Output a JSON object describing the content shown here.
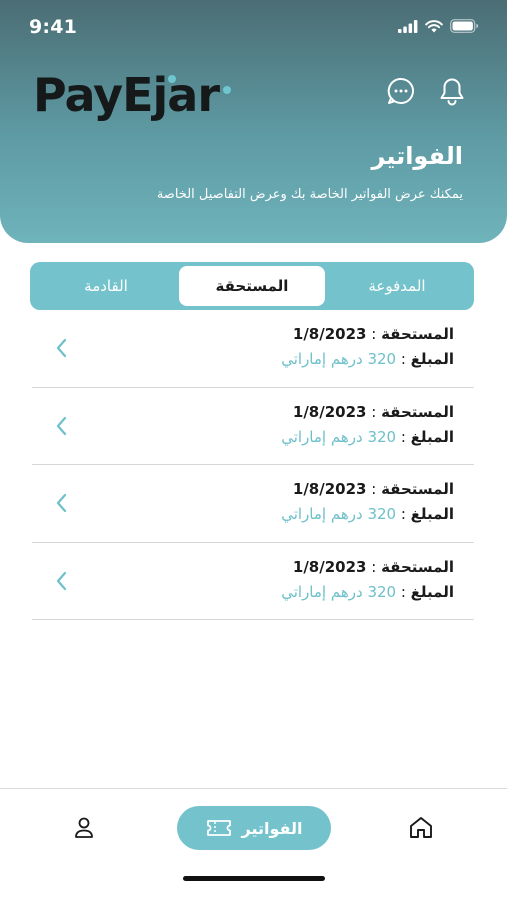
{
  "status_bar": {
    "time": "9:41"
  },
  "brand": {
    "logo_text": "PayEjar",
    "accent_color": "#6ec7d0"
  },
  "header": {
    "title": "الفواتير",
    "subtitle": "يمكنك عرض الفواتير الخاصة بك وعرض التفاصيل الخاصة",
    "chat_icon": "chat-bubble-icon",
    "notification_icon": "bell-icon"
  },
  "tabs": [
    {
      "label": "المدفوعة",
      "selected": false
    },
    {
      "label": "المستحقة",
      "selected": true
    },
    {
      "label": "القادمة",
      "selected": false
    }
  ],
  "invoices": [
    {
      "due_label": "المستحقة",
      "due_separator": " : ",
      "due_date": "1/8/2023",
      "amount_label": "المبلغ",
      "amount_separator": " : ",
      "amount": "320 درهم إماراتي"
    },
    {
      "due_label": "المستحقة",
      "due_separator": " : ",
      "due_date": "1/8/2023",
      "amount_label": "المبلغ",
      "amount_separator": " : ",
      "amount": "320 درهم إماراتي"
    },
    {
      "due_label": "المستحقة",
      "due_separator": " : ",
      "due_date": "1/8/2023",
      "amount_label": "المبلغ",
      "amount_separator": " : ",
      "amount": "320 درهم إماراتي"
    },
    {
      "due_label": "المستحقة",
      "due_separator": " : ",
      "due_date": "1/8/2023",
      "amount_label": "المبلغ",
      "amount_separator": " : ",
      "amount": "320 درهم إماراتي"
    }
  ],
  "bottom_nav": {
    "invoices_label": "الفواتير",
    "home_icon": "home-icon",
    "profile_icon": "user-icon",
    "invoices_icon": "ticket-icon",
    "active_color": "#74c3cc"
  }
}
